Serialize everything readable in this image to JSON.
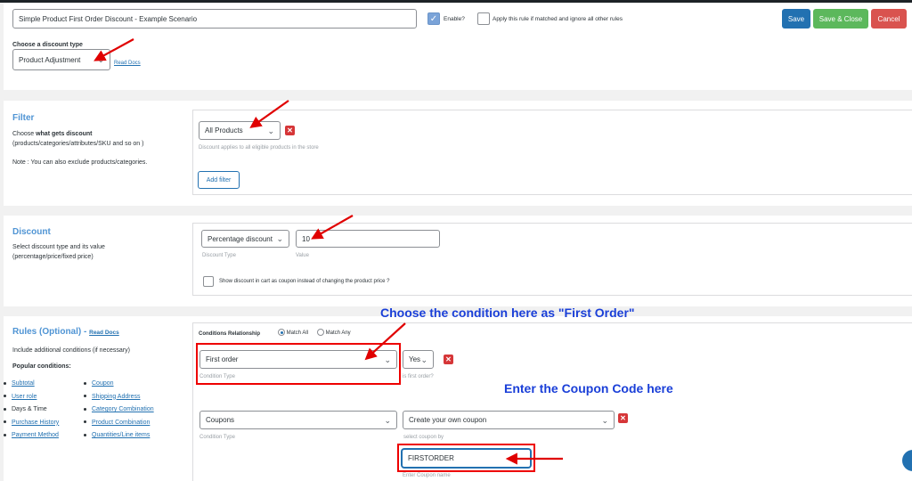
{
  "rule_title": "Simple Product First Order Discount - Example Scenario",
  "enable_label": "Enable?",
  "apply_rule_label": "Apply this rule if matched and ignore all other rules",
  "buttons": {
    "save": "Save",
    "save_close": "Save & Close",
    "cancel": "Cancel"
  },
  "discount_type": {
    "label": "Choose a discount type",
    "value": "Product Adjustment",
    "docs": "Read Docs"
  },
  "filter": {
    "title": "Filter",
    "desc_prefix": "Choose ",
    "desc_bold": "what gets discount",
    "desc_rest": "(products/categories/attributes/SKU and so on )",
    "note": "Note : You can also exclude products/categories.",
    "select_value": "All Products",
    "hint": "Discount applies to all eligible products in the store",
    "add_filter": "Add filter"
  },
  "discount": {
    "title": "Discount",
    "desc_1": "Select discount type and its value",
    "desc_2": "(percentage/price/fixed price)",
    "type_value": "Percentage discount",
    "type_hint": "Discount Type",
    "value": "10",
    "value_hint": "Value",
    "coupon_label": "Show discount in cart as coupon instead of changing the product price ?"
  },
  "rules": {
    "title": "Rules (Optional)",
    "dash": " - ",
    "docs": "Read Docs",
    "desc": "Include additional conditions (if necessary)",
    "popular_label": "Popular conditions:",
    "popular_left": [
      "Subtotal",
      "User role",
      "Days & Time",
      "Purchase History",
      "Payment Method"
    ],
    "popular_right": [
      "Coupon",
      "Shipping Address",
      "Category Combination",
      "Product Combination",
      "Quantities/Line items"
    ],
    "relationship_label": "Conditions Relationship",
    "match_all": "Match All",
    "match_any": "Match Any",
    "cond1": {
      "type": "First order",
      "type_hint": "Condition Type",
      "value": "Yes",
      "value_hint": "is first order?"
    },
    "cond2": {
      "type": "Coupons",
      "type_hint": "Condition Type",
      "select": "Create your own coupon",
      "select_hint": "select coupon by",
      "coupon_value": "FIRSTORDER",
      "coupon_hint": "Enter Coupon name"
    }
  },
  "annotations": {
    "condition_note": "Choose the condition here as \"First Order\"",
    "coupon_note": "Enter the Coupon Code here"
  },
  "colors": {
    "accent": "#4f94d4",
    "annotation": "#1a3fd8",
    "arrow": "#e00000",
    "save": "#2271b1",
    "save_close": "#5cb85c",
    "cancel": "#d9534f"
  }
}
